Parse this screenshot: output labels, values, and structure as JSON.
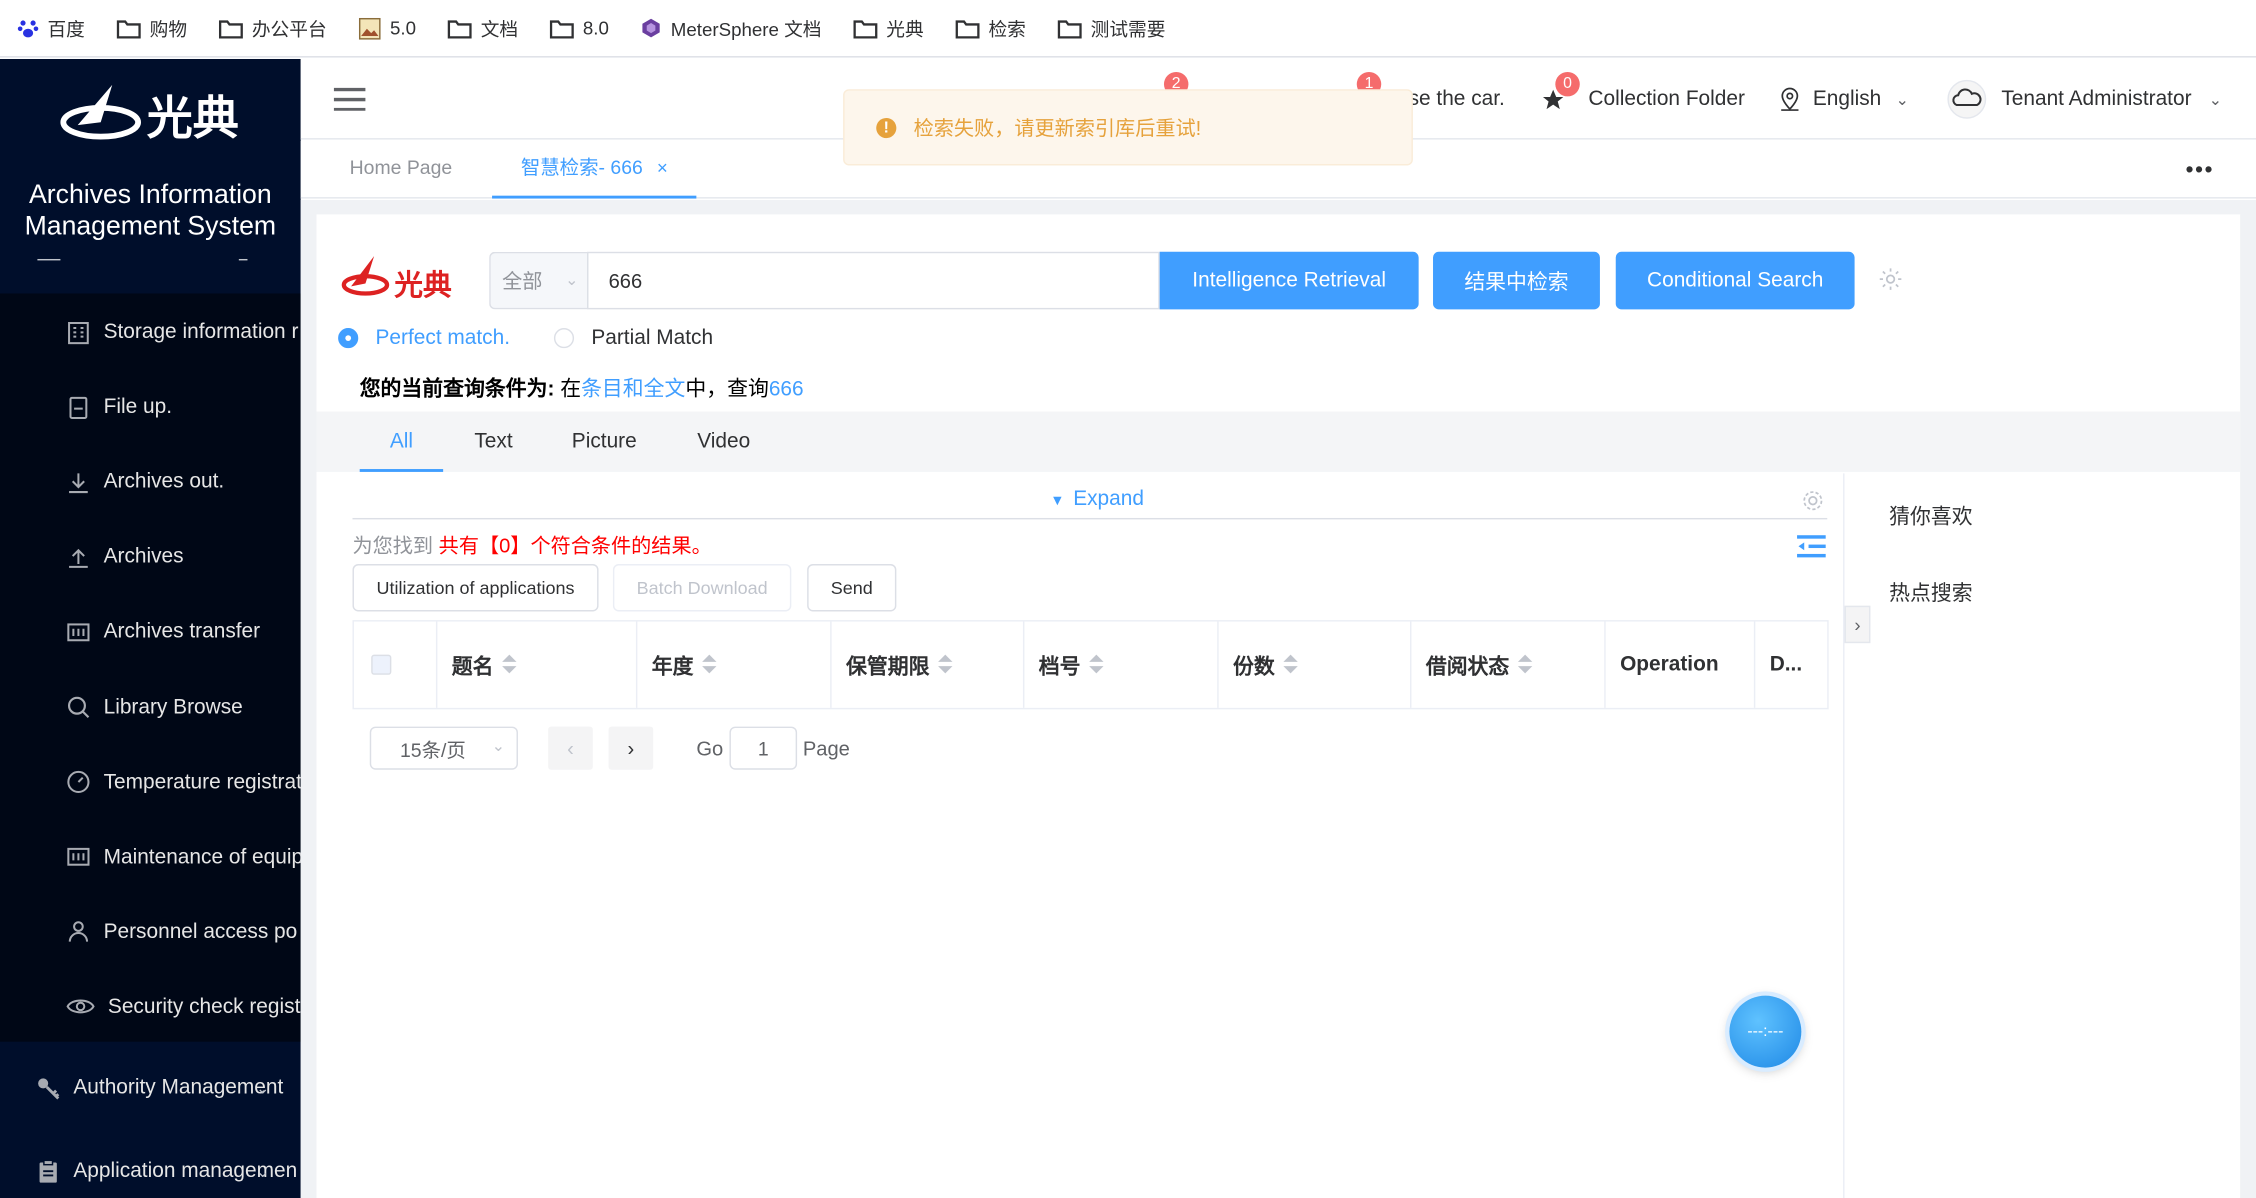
{
  "bookmarks": [
    {
      "label": "百度",
      "icon": "baidu-paw-icon"
    },
    {
      "label": "购物",
      "icon": "folder-icon"
    },
    {
      "label": "办公平台",
      "icon": "folder-icon"
    },
    {
      "label": "5.0",
      "icon": "image-icon"
    },
    {
      "label": "文档",
      "icon": "folder-icon"
    },
    {
      "label": "8.0",
      "icon": "folder-icon"
    },
    {
      "label": "MeterSphere 文档",
      "icon": "metersphere-icon"
    },
    {
      "label": "光典",
      "icon": "folder-icon"
    },
    {
      "label": "检索",
      "icon": "folder-icon"
    },
    {
      "label": "测试需要",
      "icon": "folder-icon"
    }
  ],
  "sidebar": {
    "logo_text": "光典",
    "system_title_line1": "Archives Information",
    "system_title_line2": "Management System",
    "items": [
      {
        "label": "Storage information r",
        "icon": "building-icon"
      },
      {
        "label": "File up.",
        "icon": "file-icon"
      },
      {
        "label": "Archives out.",
        "icon": "download-icon"
      },
      {
        "label": "Archives",
        "icon": "upload-icon"
      },
      {
        "label": "Archives transfer",
        "icon": "transfer-icon"
      },
      {
        "label": "Library Browse",
        "icon": "search-icon"
      },
      {
        "label": "Temperature registrat",
        "icon": "gauge-icon"
      },
      {
        "label": "Maintenance of equip",
        "icon": "equipment-icon"
      },
      {
        "label": "Personnel access po",
        "icon": "person-icon"
      },
      {
        "label": "Security check regist",
        "icon": "eye-icon"
      }
    ],
    "groups": [
      {
        "label": "Authority Management",
        "icon": "key-icon"
      },
      {
        "label": "Application managemen",
        "icon": "clipboard-icon"
      }
    ]
  },
  "header": {
    "badge1": "2",
    "badge2": "1",
    "car_text": "se the car.",
    "collection_badge": "0",
    "collection_label": "Collection Folder",
    "language": "English",
    "user": "Tenant Administrator"
  },
  "tabs": [
    {
      "label": "Home Page",
      "active": false
    },
    {
      "label": "智慧检索- 666",
      "active": true,
      "close": "×"
    }
  ],
  "toast": {
    "icon": "!",
    "message": "检索失败，请更新索引库后重试!"
  },
  "search": {
    "logo_text": "光典",
    "scope": "全部",
    "query": "666",
    "intelligence_btn": "Intelligence Retrieval",
    "in_results_btn": "结果中检索",
    "conditional_btn": "Conditional Search",
    "match_perfect": "Perfect match.",
    "match_partial": "Partial Match",
    "condition_label": "您的当前查询条件为:",
    "condition_in": "在",
    "condition_scope": "条目和全文",
    "condition_mid": "中，查询",
    "condition_query": "666"
  },
  "filter_tabs": [
    "All",
    "Text",
    "Picture",
    "Video"
  ],
  "expand_label": "Expand",
  "results": {
    "prefix": "为您找到 ",
    "count_text": "共有【0】个符合条件的结果。"
  },
  "actions": {
    "utilization": "Utilization of applications",
    "batch_download": "Batch Download",
    "send": "Send"
  },
  "table": {
    "columns": [
      "题名",
      "年度",
      "保管期限",
      "档号",
      "份数",
      "借阅状态",
      "Operation",
      "D..."
    ]
  },
  "pagination": {
    "page_size": "15条/页",
    "go_label": "Go",
    "page_value": "1",
    "page_label": "Page"
  },
  "right_panel": {
    "guess": "猜你喜欢",
    "hot": "热点搜索"
  },
  "float_button": "---:---",
  "colors": {
    "primary": "#409eff",
    "sidebar_bg": "#000e2b",
    "warning": "#e6a23c",
    "danger": "#f56c6c"
  }
}
